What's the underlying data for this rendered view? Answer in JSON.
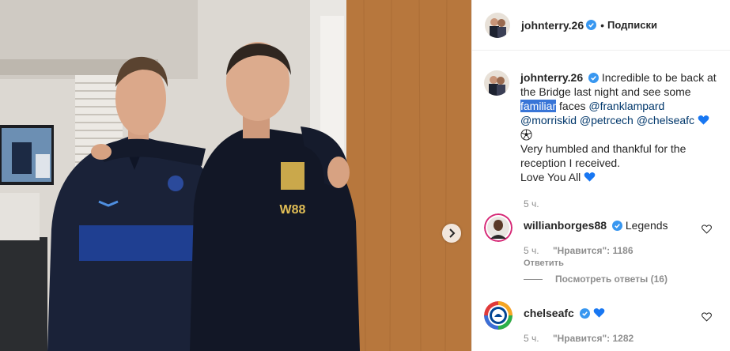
{
  "photo": {
    "jersey_text": "W88",
    "next_icon": "chevron-right-icon"
  },
  "header": {
    "username": "johnterry.26",
    "separator": "•",
    "follow_label": "Подписки"
  },
  "caption": {
    "username": "johnterry.26",
    "text_before": "Incredible to be back at the Bridge last night and see some",
    "highlighted_word": "familiar",
    "text_after": "faces",
    "mentions": [
      "@franklampard",
      "@morriskid",
      "@petrcech",
      "@chelseafc"
    ],
    "line2": "Very humbled and thankful for the reception I received.",
    "line3": "Love You All",
    "time": "5 ч."
  },
  "comments": [
    {
      "username": "willianborges88",
      "text": "Legends",
      "time": "5 ч.",
      "likes_label": "\"Нравится\": 1186",
      "reply_label": "Ответить",
      "view_replies_label": "Посмотреть ответы (16)"
    },
    {
      "username": "chelseafc",
      "text": "",
      "time": "5 ч.",
      "likes_label": "\"Нравится\": 1282"
    }
  ],
  "colors": {
    "verified": "#3897f0",
    "link": "#00376b",
    "meta": "#8e8e8e",
    "highlight": "#3875d7"
  }
}
